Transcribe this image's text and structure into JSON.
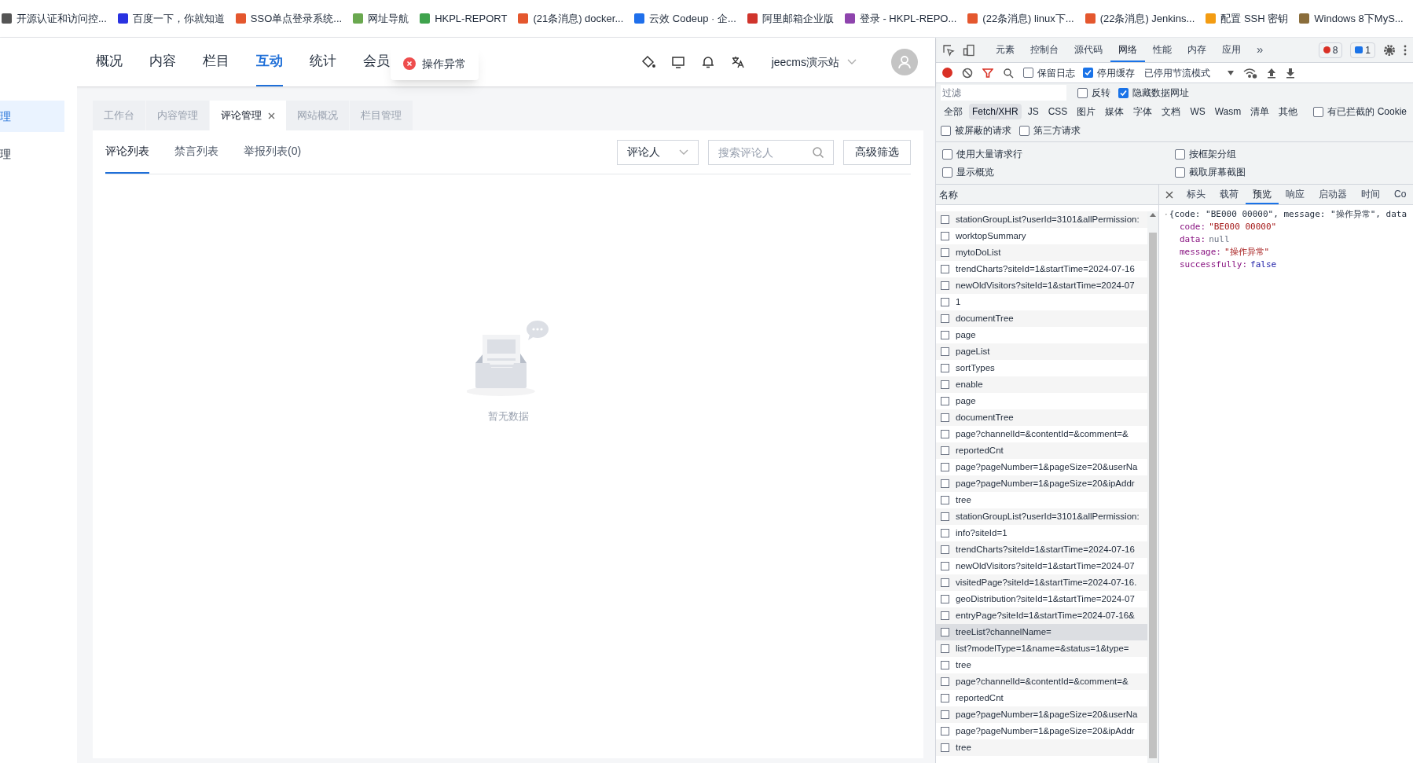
{
  "bookmarks": [
    {
      "label": "开源认证和访问控...",
      "color": "#555555"
    },
    {
      "label": "百度一下，你就知道",
      "color": "#2932e1"
    },
    {
      "label": "SSO单点登录系统...",
      "color": "#e4572e"
    },
    {
      "label": "网址导航",
      "color": "#6aa84f"
    },
    {
      "label": "HKPL-REPORT",
      "color": "#3fa34d"
    },
    {
      "label": "(21条消息) docker...",
      "color": "#e4572e"
    },
    {
      "label": "云效 Codeup · 企...",
      "color": "#1f6feb"
    },
    {
      "label": "阿里邮箱企业版",
      "color": "#d0342c"
    },
    {
      "label": "登录 - HKPL-REPO...",
      "color": "#8e44ad"
    },
    {
      "label": "(22条消息) linux下...",
      "color": "#e4572e"
    },
    {
      "label": "(22条消息) Jenkins...",
      "color": "#e4572e"
    },
    {
      "label": "配置 SSH 密钥",
      "color": "#f39c12"
    },
    {
      "label": "Windows 8下MyS...",
      "color": "#8a6d3b"
    }
  ],
  "app": {
    "nav": [
      {
        "label": "概况",
        "selected": false
      },
      {
        "label": "内容",
        "selected": false
      },
      {
        "label": "栏目",
        "selected": false
      },
      {
        "label": "互动",
        "selected": true
      },
      {
        "label": "统计",
        "selected": false
      },
      {
        "label": "会员",
        "selected": false
      }
    ],
    "toast": "操作异常",
    "site": "jeecms演示站",
    "sidebar": [
      {
        "label": "理",
        "selected": true
      },
      {
        "label": "理",
        "selected": false
      }
    ],
    "page_tabs": [
      {
        "label": "工作台",
        "selected": false,
        "closable": false
      },
      {
        "label": "内容管理",
        "selected": false,
        "closable": false
      },
      {
        "label": "评论管理",
        "selected": true,
        "closable": true
      },
      {
        "label": "网站概况",
        "selected": false,
        "closable": false
      },
      {
        "label": "栏目管理",
        "selected": false,
        "closable": false
      }
    ],
    "sub_tabs": [
      {
        "label": "评论列表",
        "selected": true
      },
      {
        "label": "禁言列表",
        "selected": false
      },
      {
        "label": "举报列表(0)",
        "selected": false
      }
    ],
    "filter_select": "评论人",
    "search": {
      "placeholder": "搜索评论人"
    },
    "advanced_button": "高级筛选",
    "empty_text": "暂无数据"
  },
  "devtools": {
    "tabs": [
      {
        "label": "元素",
        "selected": false
      },
      {
        "label": "控制台",
        "selected": false
      },
      {
        "label": "源代码",
        "selected": false
      },
      {
        "label": "网络",
        "selected": true
      },
      {
        "label": "性能",
        "selected": false
      },
      {
        "label": "内存",
        "selected": false
      },
      {
        "label": "应用",
        "selected": false
      }
    ],
    "more": "»",
    "errors": "8",
    "messages": "1",
    "toolbar_checks": [
      {
        "label": "保留日志",
        "checked": false
      },
      {
        "label": "停用缓存",
        "checked": true
      }
    ],
    "throttle": "已停用节流模式",
    "filter": {
      "placeholder": "过滤"
    },
    "filter_checks": [
      {
        "label": "反转",
        "checked": false
      },
      {
        "label": "隐藏数据网址",
        "checked": true
      }
    ],
    "types": [
      {
        "label": "全部",
        "selected": false
      },
      {
        "label": "Fetch/XHR",
        "selected": true
      },
      {
        "label": "JS",
        "selected": false
      },
      {
        "label": "CSS",
        "selected": false
      },
      {
        "label": "图片",
        "selected": false
      },
      {
        "label": "媒体",
        "selected": false
      },
      {
        "label": "字体",
        "selected": false
      },
      {
        "label": "文档",
        "selected": false
      },
      {
        "label": "WS",
        "selected": false
      },
      {
        "label": "Wasm",
        "selected": false
      },
      {
        "label": "清单",
        "selected": false
      },
      {
        "label": "其他",
        "selected": false
      }
    ],
    "cookie_check": {
      "label": "有已拦截的 Cookie",
      "checked": false
    },
    "extra_checks": [
      {
        "label": "被屏蔽的请求",
        "checked": false
      },
      {
        "label": "第三方请求",
        "checked": false
      }
    ],
    "settings": [
      {
        "label": "使用大量请求行",
        "checked": false
      },
      {
        "label": "按框架分组",
        "checked": false
      },
      {
        "label": "显示概览",
        "checked": false
      },
      {
        "label": "截取屏幕截图",
        "checked": false
      }
    ],
    "name_header": "名称",
    "requests": [
      {
        "name": "stationGroupList?userId=3101&allPermission:",
        "selected": false
      },
      {
        "name": "worktopSummary",
        "selected": false
      },
      {
        "name": "mytoDoList",
        "selected": false
      },
      {
        "name": "trendCharts?siteId=1&startTime=2024-07-16",
        "selected": false
      },
      {
        "name": "newOldVisitors?siteId=1&startTime=2024-07",
        "selected": false
      },
      {
        "name": "1",
        "selected": false
      },
      {
        "name": "documentTree",
        "selected": false
      },
      {
        "name": "page",
        "selected": false
      },
      {
        "name": "pageList",
        "selected": false
      },
      {
        "name": "sortTypes",
        "selected": false
      },
      {
        "name": "enable",
        "selected": false
      },
      {
        "name": "page",
        "selected": false
      },
      {
        "name": "documentTree",
        "selected": false
      },
      {
        "name": "page?channelId=&contentId=&comment=&",
        "selected": false
      },
      {
        "name": "reportedCnt",
        "selected": false
      },
      {
        "name": "page?pageNumber=1&pageSize=20&userNa",
        "selected": false
      },
      {
        "name": "page?pageNumber=1&pageSize=20&ipAddr",
        "selected": false
      },
      {
        "name": "tree",
        "selected": false
      },
      {
        "name": "stationGroupList?userId=3101&allPermission:",
        "selected": false
      },
      {
        "name": "info?siteId=1",
        "selected": false
      },
      {
        "name": "trendCharts?siteId=1&startTime=2024-07-16",
        "selected": false
      },
      {
        "name": "newOldVisitors?siteId=1&startTime=2024-07",
        "selected": false
      },
      {
        "name": "visitedPage?siteId=1&startTime=2024-07-16.",
        "selected": false
      },
      {
        "name": "geoDistribution?siteId=1&startTime=2024-07",
        "selected": false
      },
      {
        "name": "entryPage?siteId=1&startTime=2024-07-16&",
        "selected": false
      },
      {
        "name": "treeList?channelName=",
        "selected": true
      },
      {
        "name": "list?modelType=1&name=&status=1&type=",
        "selected": false
      },
      {
        "name": "tree",
        "selected": false
      },
      {
        "name": "page?channelId=&contentId=&comment=&",
        "selected": false
      },
      {
        "name": "reportedCnt",
        "selected": false
      },
      {
        "name": "page?pageNumber=1&pageSize=20&userNa",
        "selected": false
      },
      {
        "name": "page?pageNumber=1&pageSize=20&ipAddr",
        "selected": false
      },
      {
        "name": "tree",
        "selected": false
      }
    ],
    "detail_tabs": [
      {
        "label": "标头",
        "selected": false
      },
      {
        "label": "载荷",
        "selected": false
      },
      {
        "label": "预览",
        "selected": true
      },
      {
        "label": "响应",
        "selected": false
      },
      {
        "label": "启动器",
        "selected": false
      },
      {
        "label": "时间",
        "selected": false
      },
      {
        "label": "Co",
        "selected": false
      }
    ],
    "preview": {
      "summary": "{code: \"BE000 00000\", message: \"操作异常\", data",
      "fields": [
        {
          "key": "code:",
          "value": "\"BE000 00000\"",
          "kind": "string"
        },
        {
          "key": "data:",
          "value": "null",
          "kind": "null"
        },
        {
          "key": "message:",
          "value": "\"操作异常\"",
          "kind": "string"
        },
        {
          "key": "successfully:",
          "value": "false",
          "kind": "boolean"
        }
      ]
    }
  }
}
